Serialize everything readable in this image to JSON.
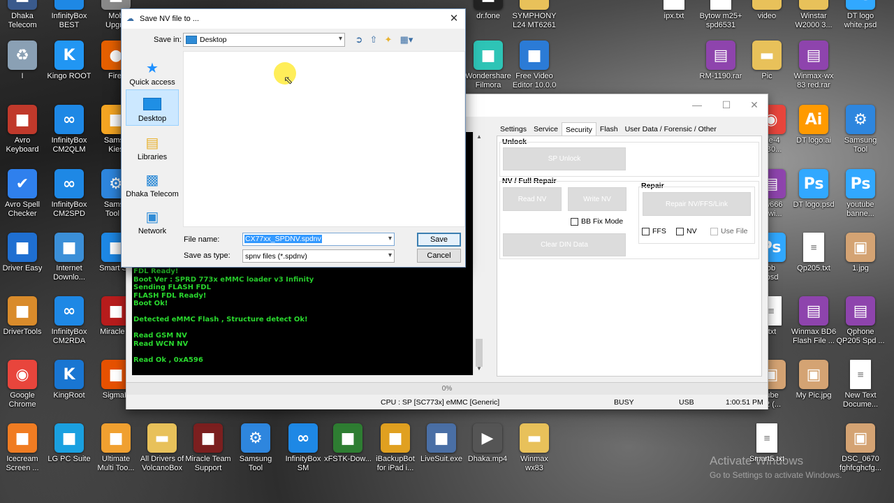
{
  "desktop": {
    "icons_col1": [
      {
        "label": "Dhaka\nTelecom",
        "icon": "dhaka-telecom-icon"
      },
      {
        "label": "I",
        "icon": "recycle-bin-icon"
      },
      {
        "label": "Avro\nKeyboard",
        "icon": "avro-keyboard-icon"
      },
      {
        "label": "Avro Spell\nChecker",
        "icon": "avro-spell-checker-icon"
      },
      {
        "label": "Driver Easy",
        "icon": "driver-easy-icon"
      },
      {
        "label": "DriverTools",
        "icon": "driver-tools-icon"
      },
      {
        "label": "Google\nChrome",
        "icon": "chrome-icon"
      },
      {
        "label": "Icecream\nScreen ...",
        "icon": "icecream-icon"
      }
    ],
    "icons_col2": [
      {
        "label": "InfinityBox\nBEST",
        "icon": "infinitybox-icon"
      },
      {
        "label": "Kingo ROOT",
        "icon": "kingo-root-icon"
      },
      {
        "label": "InfinityBox\nCM2QLM",
        "icon": "infinitybox-icon"
      },
      {
        "label": "InfinityBox\nCM2SPD",
        "icon": "infinitybox-icon"
      },
      {
        "label": "Internet\nDownlo...",
        "icon": "internet-download-icon"
      },
      {
        "label": "InfinityBox\nCM2RDA",
        "icon": "infinitybox-icon"
      },
      {
        "label": "KingRoot",
        "icon": "kingroot-icon"
      },
      {
        "label": "LG PC Suite",
        "icon": "lg-pc-suite-icon"
      }
    ],
    "icons_col3": [
      {
        "label": "Mob\nUpgra",
        "icon": "mobile-upgrade-icon"
      },
      {
        "label": "Firef",
        "icon": "firefox-icon"
      },
      {
        "label": "Samsu\nKies",
        "icon": "samsung-kies-icon"
      },
      {
        "label": "Samsu\nTool P",
        "icon": "samsung-tool-icon"
      },
      {
        "label": "Smart Sw",
        "icon": "smart-switch-icon"
      },
      {
        "label": "Miracle E",
        "icon": "miracle-icon"
      },
      {
        "label": "SigmaK",
        "icon": "sigmakey-icon"
      }
    ],
    "icons_bottom": [
      {
        "label": "Ultimate\nMulti Too...",
        "icon": "ultimate-multi-tool-icon"
      },
      {
        "label": "All Drivers of\nVolcanoBox",
        "icon": "folder-icon"
      },
      {
        "label": "Miracle Team\nSupport",
        "icon": "miracle-team-icon"
      },
      {
        "label": "Samsung\nTool",
        "icon": "samsung-tool-icon"
      },
      {
        "label": "InfinityBox\nSM",
        "icon": "infinitybox-icon"
      },
      {
        "label": "xFSTK-Dow...",
        "icon": "xfstk-icon"
      },
      {
        "label": "iBackupBot\nfor iPad i...",
        "icon": "ibackupbot-icon"
      },
      {
        "label": "LiveSuit.exe",
        "icon": "livesuit-icon"
      },
      {
        "label": "Dhaka.mp4",
        "icon": "video-file-icon"
      },
      {
        "label": "Winmax\nwx83",
        "icon": "folder-icon"
      }
    ],
    "icons_mid_top": [
      {
        "label": "dr.fone",
        "icon": "drfone-icon"
      },
      {
        "label": "SYMPHONY\nL24 MT6261",
        "icon": "folder-icon"
      },
      {
        "label": "Wondershare\nFilmora",
        "icon": "filmora-icon"
      },
      {
        "label": "Free Video\nEditor 10.0.0",
        "icon": "free-video-editor-icon"
      }
    ],
    "icons_right": [
      {
        "label": "ipx.txt",
        "icon": "text-file-icon"
      },
      {
        "label": "Bytow m25+\nspd6531",
        "icon": "text-file-icon"
      },
      {
        "label": "video",
        "icon": "folder-icon"
      },
      {
        "label": "Winstar\nW2000 3...",
        "icon": "folder-icon"
      },
      {
        "label": "DT logo\nwhite.psd",
        "icon": "psd-file-icon"
      },
      {
        "label": "RM-1190.rar",
        "icon": "rar-file-icon"
      },
      {
        "label": "Pic",
        "icon": "folder-icon"
      },
      {
        "label": "Winmax-wx\n83 red.rar",
        "icon": "rar-file-icon"
      },
      {
        "label": "rse-4\nCB0...",
        "icon": "chrome-icon"
      },
      {
        "label": "DT logo.ai",
        "icon": "ai-file-icon"
      },
      {
        "label": "Samsung\nTool",
        "icon": "samsung-tool-icon"
      },
      {
        "label": "r w666\nle wi...",
        "icon": "rar-file-icon"
      },
      {
        "label": "DT logo.psd",
        "icon": "psd-file-icon"
      },
      {
        "label": "youtube\nbanne...",
        "icon": "psd-file-icon"
      },
      {
        "label": "ob\n.psd",
        "icon": "psd-file-icon"
      },
      {
        "label": "Qp205.txt",
        "icon": "text-file-icon"
      },
      {
        "label": "1.jpg",
        "icon": "image-file-icon"
      },
      {
        "label": ".txt",
        "icon": "text-file-icon"
      },
      {
        "label": "Winmax BD6\nFlash File ...",
        "icon": "rar-file-icon"
      },
      {
        "label": "Qphone\nQP205 Spd ...",
        "icon": "rar-file-icon"
      },
      {
        "label": "tube\n02 (...",
        "icon": "image-file-icon"
      },
      {
        "label": "My Pic.jpg",
        "icon": "image-file-icon"
      },
      {
        "label": "New Text\nDocume...",
        "icon": "text-file-icon"
      },
      {
        "label": "Smart5.txt",
        "icon": "text-file-icon"
      },
      {
        "label": "DSC_0670\nfghfcghcfg...",
        "icon": "image-file-icon"
      }
    ]
  },
  "tool": {
    "tabs": [
      "Settings",
      "Service",
      "Security",
      "Flash",
      "User Data / Forensic / Other"
    ],
    "active_tab": "Security",
    "unlock_title": "Unlock",
    "sp_unlock": "SP Unlock",
    "nv_title": "NV / Full Repair",
    "read_nv": "Read NV",
    "write_nv": "Write NV",
    "bb_fix_mode": "BB Fix Mode",
    "clear_din": "Clear DIN Data",
    "repair_title": "Repair",
    "repair_btn": "Repair NV/FFS/Link",
    "ffs": "FFS",
    "nv": "NV",
    "use_file": "Use File",
    "log_lines": [
      "FDL Ready!",
      "Boot Ver : SPRD 773x eMMC loader v3 Infinity",
      "Sending FLASH FDL",
      "FLASH FDL Ready!",
      "Boot Ok!",
      "",
      "Detected eMMC Flash , Structure detect Ok!",
      "",
      "Read GSM NV",
      "Read WCN NV",
      "",
      "Read Ok , 0xA596"
    ],
    "progress_text": "0%",
    "progress_value": 0,
    "status_cpu": "CPU : SP [SC773x] eMMC [Generic]",
    "status_busy": "BUSY",
    "status_usb": "USB",
    "status_time": "1:00:51 PM"
  },
  "dialog": {
    "title": "Save NV file to ...",
    "save_in_label": "Save in:",
    "save_in_value": "Desktop",
    "places": [
      "Quick access",
      "Desktop",
      "Libraries",
      "Dhaka Telecom",
      "Network"
    ],
    "selected_place": "Desktop",
    "file_name_label": "File name:",
    "file_name_value": "CX77xx_SPDNV.spdnv",
    "save_as_type_label": "Save as type:",
    "save_as_type_value": "spnv files (*.spdnv)",
    "save_button": "Save",
    "cancel_button": "Cancel"
  },
  "watermark": {
    "line1": "Activate Windows",
    "line2": "Go to Settings to activate Windows."
  },
  "colors": {
    "log_text": "#29d82e",
    "selection": "#3399ff",
    "place_selected": "#cce8ff"
  }
}
